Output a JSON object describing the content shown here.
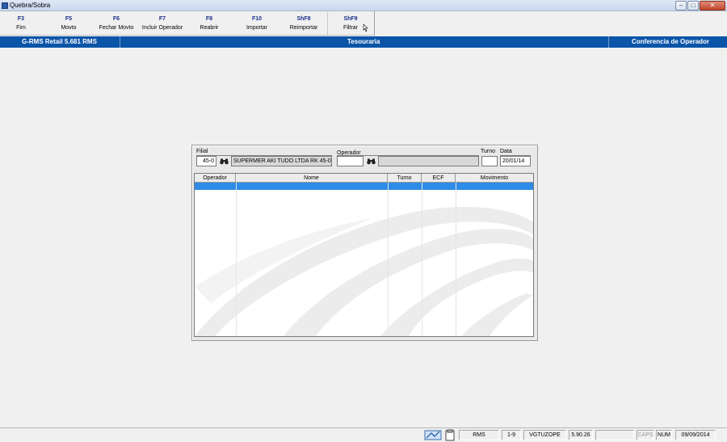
{
  "window": {
    "title": "Quebra/Sobra",
    "minimize_glyph": "–",
    "maximize_glyph": "□",
    "close_glyph": "✕"
  },
  "toolbar": {
    "buttons": [
      {
        "key": "F3",
        "label": "Fim"
      },
      {
        "key": "F5",
        "label": "Movto"
      },
      {
        "key": "F6",
        "label": "Fechar Movto"
      },
      {
        "key": "F7",
        "label": "Incluir Operador"
      },
      {
        "key": "F8",
        "label": "Reabrir"
      },
      {
        "key": "F10",
        "label": "Importar"
      },
      {
        "key": "ShF8",
        "label": "Reimportar"
      },
      {
        "key": "ShF9",
        "label": "Filtrar"
      }
    ]
  },
  "header": {
    "left": "G-RMS Retail 5.681 RMS",
    "center": "Tesouraria",
    "right": "Conferencia de Operador",
    "color": "#0b55a8"
  },
  "form": {
    "filial_label": "Filial",
    "filial_value": "45-0",
    "filial_name": "SUPERMER AKI TUDO LTDA RK 45-0",
    "operador_label": "Operador",
    "operador_value": "",
    "operador_name": "",
    "turno_label": "Turno",
    "turno_value": "",
    "data_label": "Data",
    "data_value": "20/01/14"
  },
  "grid": {
    "columns": [
      "Operador",
      "Nome",
      "Turno",
      "ECF",
      "Movimento"
    ],
    "selected_color": "#2e8be6"
  },
  "statusbar": {
    "cells": [
      "RMS",
      "1-9",
      "VGTUZOPE",
      "5.90.26",
      "",
      "CAPS",
      "NUM",
      "09/09/2014"
    ]
  }
}
